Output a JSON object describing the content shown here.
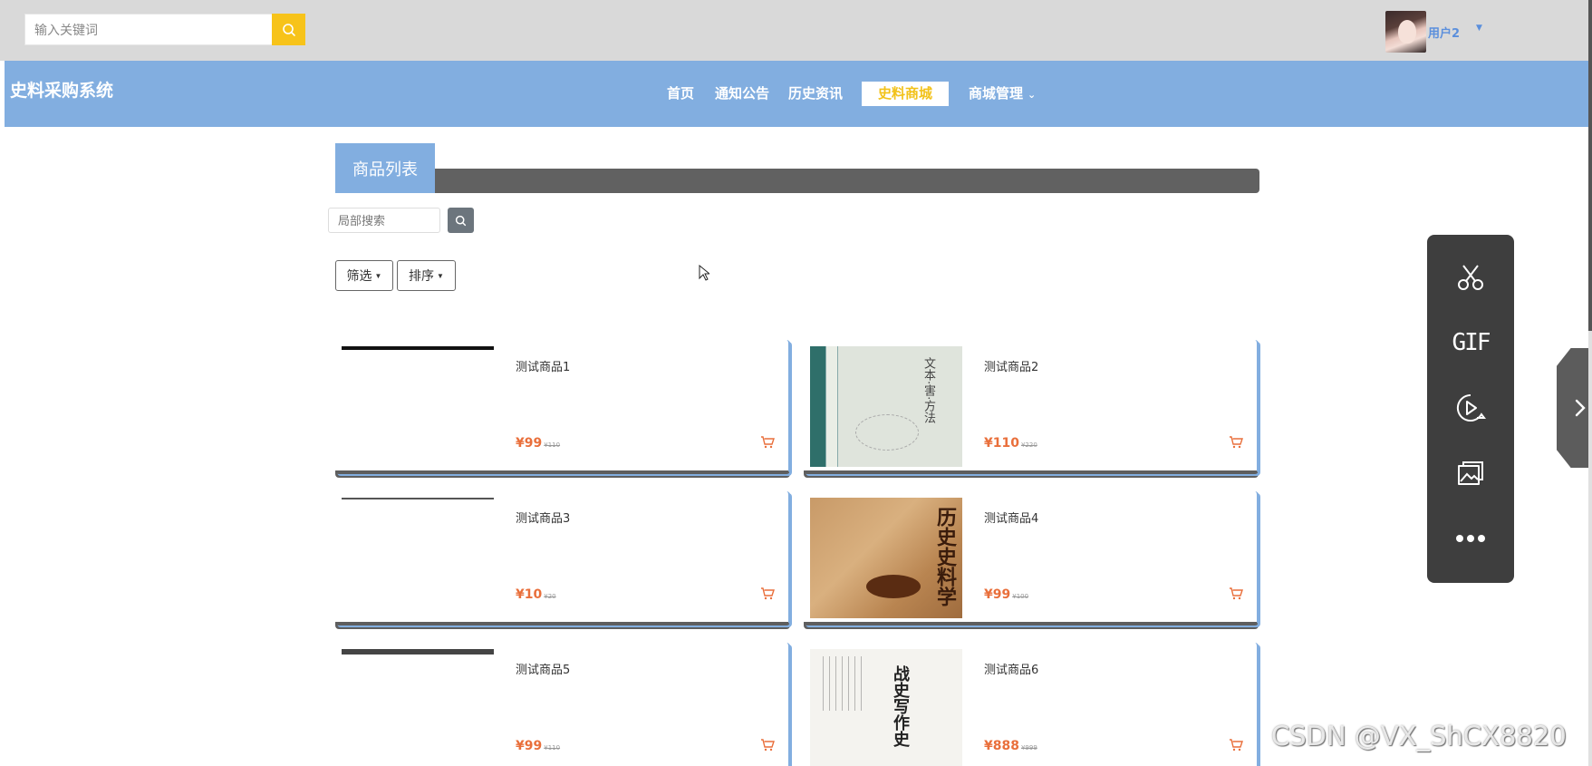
{
  "header": {
    "search_placeholder": "输入关键词",
    "username": "用户2"
  },
  "nav": {
    "site_title": "史料采购系统",
    "items": [
      {
        "label": "首页"
      },
      {
        "label": "通知公告"
      },
      {
        "label": "历史资讯"
      },
      {
        "label": "史料商城"
      },
      {
        "label": "商城管理"
      }
    ],
    "active": "史料商城"
  },
  "section": {
    "title": "商品列表",
    "local_search_placeholder": "局部搜索",
    "filter_label": "筛选",
    "sort_label": "排序"
  },
  "products": [
    {
      "name": "测试商品1",
      "price": "¥99",
      "original": "¥110"
    },
    {
      "name": "测试商品2",
      "price": "¥110",
      "original": "¥220",
      "cover_text": "文本·害·方法"
    },
    {
      "name": "测试商品3",
      "price": "¥10",
      "original": "¥20"
    },
    {
      "name": "测试商品4",
      "price": "¥99",
      "original": "¥100",
      "cover_text": "历史史料学"
    },
    {
      "name": "测试商品5",
      "price": "¥99",
      "original": "¥110"
    },
    {
      "name": "测试商品6",
      "price": "¥888",
      "original": "¥999",
      "cover_text": "战史写作史"
    }
  ],
  "toolbar": {
    "gif_label": "GIF"
  },
  "watermark": "CSDN @VX_ShCX8820",
  "colors": {
    "nav_blue": "#82aee0",
    "accent_yellow": "#f7c31a",
    "price_orange": "#e96f3b",
    "dark_gray": "#616161"
  }
}
